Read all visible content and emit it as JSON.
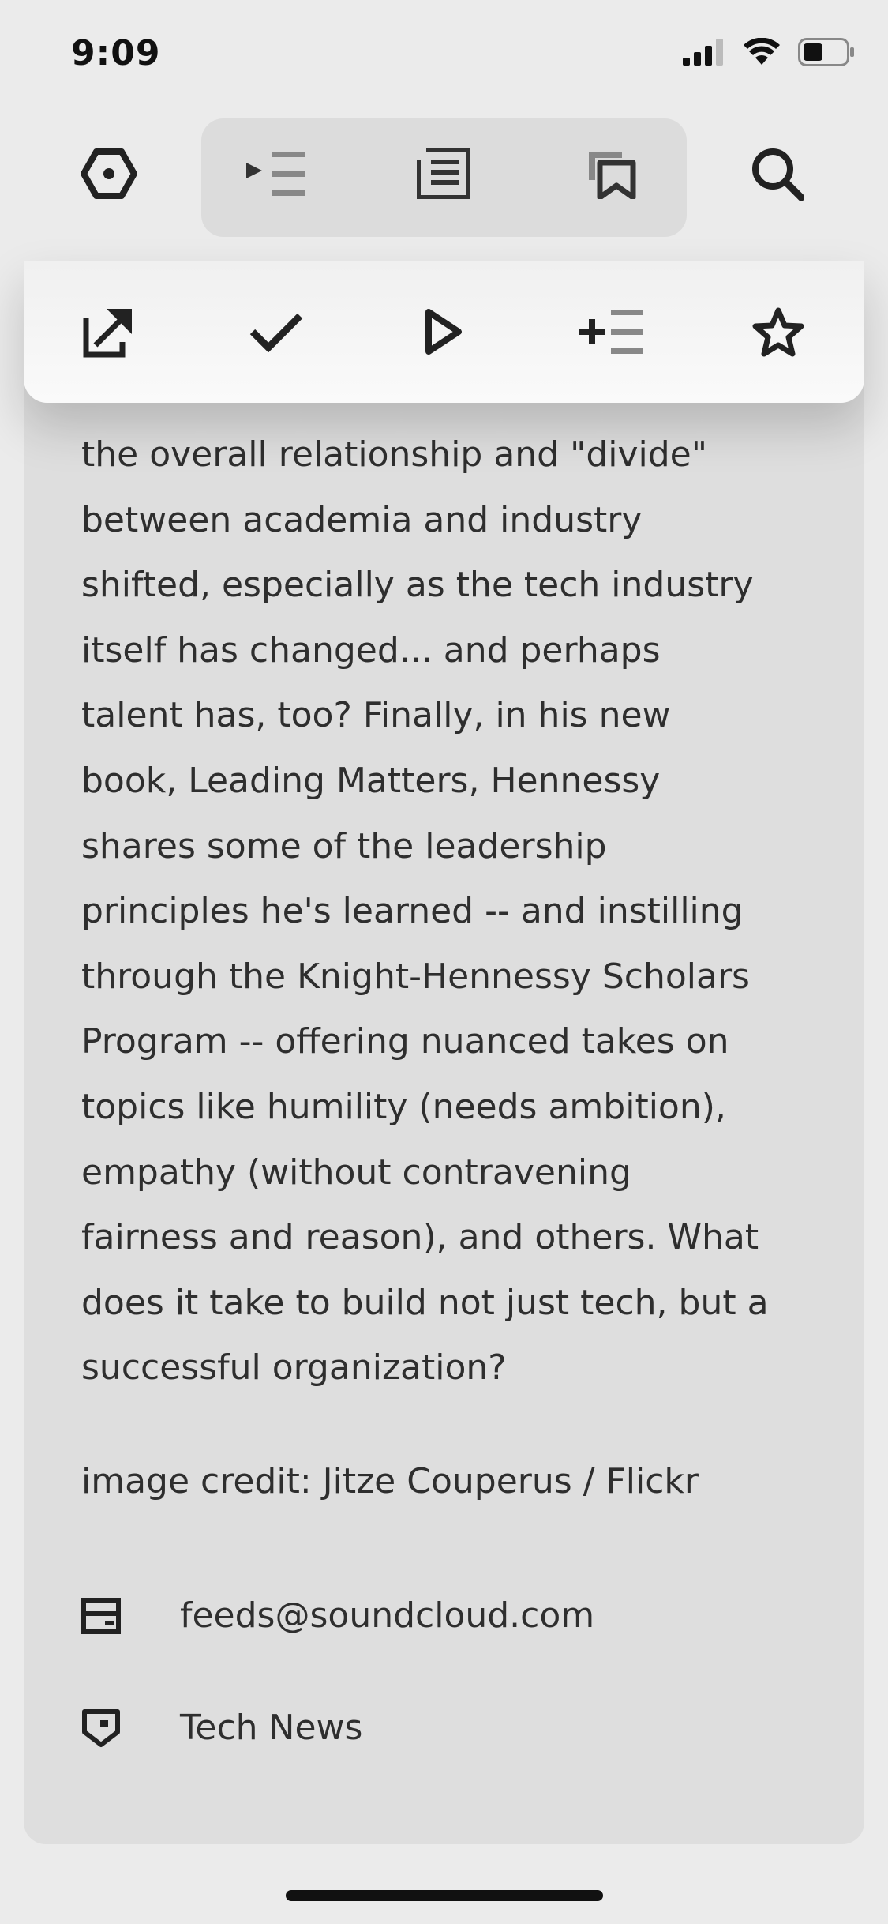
{
  "status_bar": {
    "time": "9:09",
    "icons": [
      "cellular-signal-icon",
      "wifi-icon",
      "battery-icon"
    ]
  },
  "navbar": {
    "left_icon": "settings-hexagon-icon",
    "segments": [
      "queue-icon",
      "article-list-icon",
      "bookmarks-icon"
    ],
    "right_icon": "search-icon"
  },
  "actions": [
    "open-external-icon",
    "mark-read-icon",
    "play-icon",
    "add-to-queue-icon",
    "favorite-star-icon"
  ],
  "article": {
    "body": "the overall relationship and \"divide\"\nbetween academia and industry\nshifted, especially as the tech industry\nitself has changed... and perhaps\ntalent has, too? Finally, in his new\nbook, Leading Matters, Hennessy\nshares some of the leadership\nprinciples he's learned -- and instilling\nthrough the Knight-Hennessy Scholars\nProgram -- offering nuanced takes on\ntopics like humility (needs ambition),\nempathy (without contravening\nfairness and reason), and others. What\ndoes it take to build not just tech, but a\nsuccessful organization?",
    "credit": "image credit: Jitze Couperus / Flickr",
    "author_email": "feeds@soundcloud.com",
    "feed_name": "Tech News"
  },
  "colors": {
    "background": "#ebebeb",
    "card": "#dedede",
    "segment": "#dcdcdc",
    "icon": "#222222"
  }
}
